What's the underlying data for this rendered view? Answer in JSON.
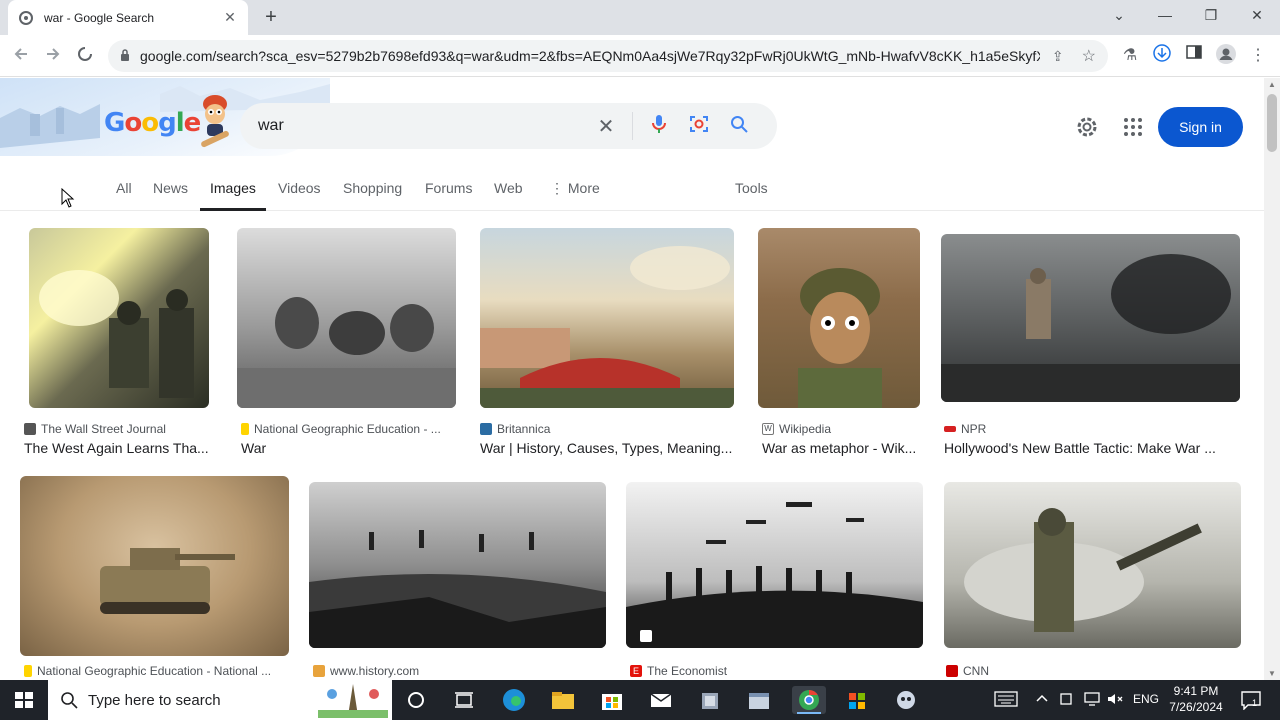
{
  "tab": {
    "title": "war - Google Search",
    "close": "✕",
    "new_tab": "+"
  },
  "window": {
    "minimize": "—",
    "restore": "❐",
    "close": "✕",
    "dropdown": "⌄"
  },
  "address": {
    "url": "google.com/search?sca_esv=5279b2b7698efd93&q=war&udm=2&fbs=AEQNm0Aa4sjWe7Rqy32pFwRj0UkWtG_mNb-HwafvV8cKK_h1a5eSkyfX..."
  },
  "search": {
    "query": "war",
    "signin": "Sign in"
  },
  "logo": {
    "letters": [
      "G",
      "o",
      "o",
      "g",
      "l",
      "e"
    ],
    "colors": [
      "#4285f4",
      "#ea4335",
      "#fbbc05",
      "#4285f4",
      "#34a853",
      "#ea4335"
    ]
  },
  "nav": {
    "tabs": [
      "All",
      "News",
      "Images",
      "Videos",
      "Shopping",
      "Forums",
      "Web",
      "More"
    ],
    "tools": "Tools",
    "active": "Images"
  },
  "results": [
    {
      "source": "The Wall Street Journal",
      "caption": "The West Again Learns Tha...",
      "favcolor": "#555"
    },
    {
      "source": "National Geographic Education - ...",
      "caption": "War",
      "favcolor": "#ffd400"
    },
    {
      "source": "Britannica",
      "caption": "War | History, Causes, Types, Meaning...",
      "favcolor": "#2b6ca3"
    },
    {
      "source": "Wikipedia",
      "caption": "War as metaphor - Wik...",
      "favcolor": "#777"
    },
    {
      "source": "NPR",
      "caption": "Hollywood's New Battle Tactic: Make War ...",
      "favcolor": "#d62021"
    },
    {
      "source": "National Geographic Education - National ...",
      "caption": "",
      "favcolor": "#ffd400"
    },
    {
      "source": "www.history.com",
      "caption": "",
      "favcolor": "#e8a33c"
    },
    {
      "source": "The Economist",
      "caption": "",
      "favcolor": "#e3120b"
    },
    {
      "source": "CNN",
      "caption": "",
      "favcolor": "#cc0000"
    }
  ],
  "taskbar": {
    "search_placeholder": "Type here to search",
    "lang": "ENG",
    "time": "9:41 PM",
    "date": "7/26/2024",
    "notif": "1"
  }
}
